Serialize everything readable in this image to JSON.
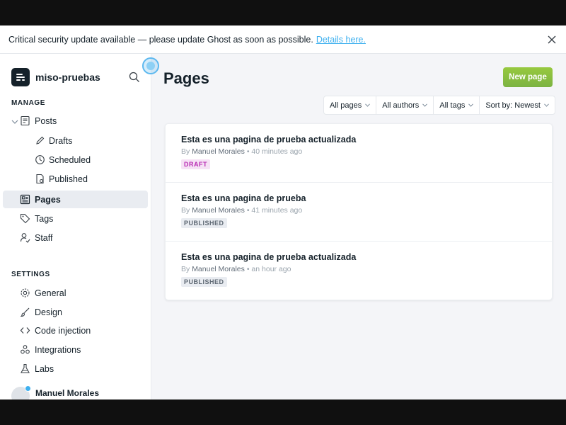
{
  "alert": {
    "message": "Critical security update available — please update Ghost as soon as possible.",
    "link": "Details here.",
    "close_icon": "close-icon"
  },
  "sidebar": {
    "site_name": "miso-pruebas",
    "manage_label": "MANAGE",
    "settings_label": "SETTINGS",
    "manage_items": [
      {
        "label": "Posts",
        "icon": "posts-icon"
      },
      {
        "label": "Drafts",
        "icon": "pencil-icon"
      },
      {
        "label": "Scheduled",
        "icon": "clock-icon"
      },
      {
        "label": "Published",
        "icon": "published-icon"
      },
      {
        "label": "Pages",
        "icon": "pages-icon",
        "active": true
      },
      {
        "label": "Tags",
        "icon": "tag-icon"
      },
      {
        "label": "Staff",
        "icon": "staff-icon"
      }
    ],
    "settings_items": [
      {
        "label": "General",
        "icon": "gear-icon"
      },
      {
        "label": "Design",
        "icon": "brush-icon"
      },
      {
        "label": "Code injection",
        "icon": "code-icon"
      },
      {
        "label": "Integrations",
        "icon": "integrations-icon"
      },
      {
        "label": "Labs",
        "icon": "flask-icon"
      }
    ],
    "user_name": "Manuel Morales"
  },
  "main": {
    "title": "Pages",
    "new_button": "New page",
    "filters": [
      "All pages",
      "All authors",
      "All tags",
      "Sort by: Newest"
    ],
    "pages": [
      {
        "title": "Esta es una pagina de prueba actualizada",
        "by": "By",
        "author": "Manuel Morales",
        "time": "40 minutes ago",
        "status": "DRAFT"
      },
      {
        "title": "Esta es una pagina de prueba",
        "by": "By",
        "author": "Manuel Morales",
        "time": "41 minutes ago",
        "status": "PUBLISHED"
      },
      {
        "title": "Esta es una pagina de prueba actualizada",
        "by": "By",
        "author": "Manuel Morales",
        "time": "an hour ago",
        "status": "PUBLISHED"
      }
    ]
  },
  "colors": {
    "accent_green": "#7cb342",
    "link_blue": "#3eb0ef",
    "draft_pink": "#b82bb3",
    "text_dark": "#15212a"
  }
}
